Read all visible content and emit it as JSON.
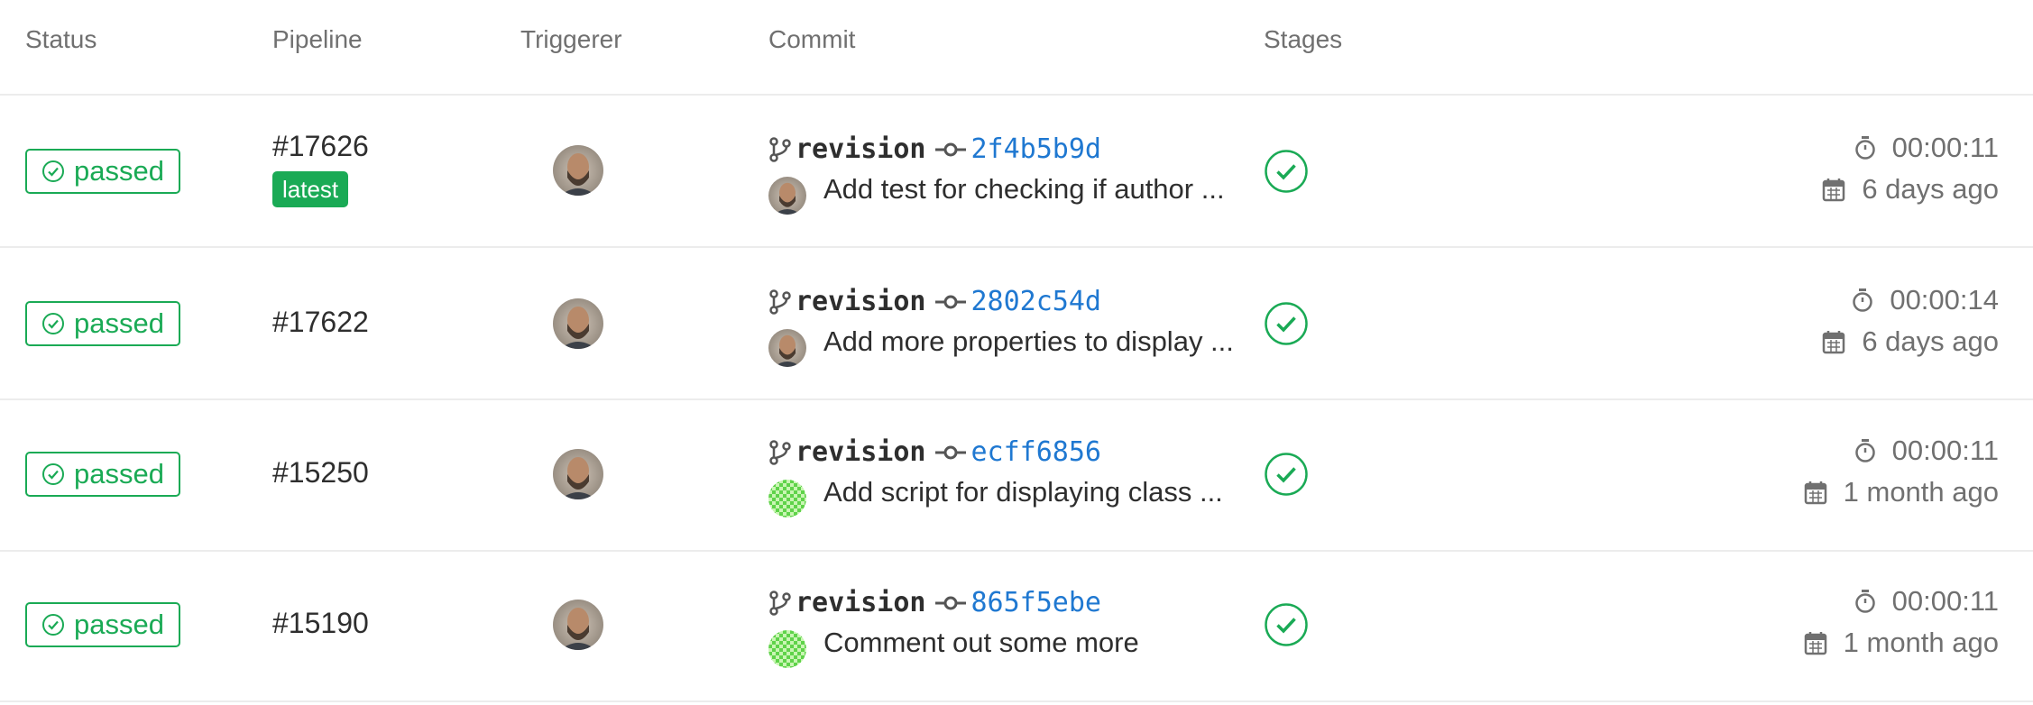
{
  "headers": {
    "status": "Status",
    "pipeline": "Pipeline",
    "triggerer": "Triggerer",
    "commit": "Commit",
    "stages": "Stages"
  },
  "colors": {
    "success": "#1aaa55",
    "link": "#1f78d1",
    "muted": "#707070",
    "text": "#2e2e2e"
  },
  "icons": {
    "status": "status-success-icon",
    "branch": "branch-icon",
    "commit": "commit-icon",
    "stage": "stage-success-icon",
    "duration": "timer-icon",
    "finished": "calendar-icon"
  },
  "rows": [
    {
      "status": "passed",
      "pipeline": "#17626",
      "badge": "latest",
      "branch": "revision",
      "sha": "2f4b5b9d",
      "commit_title": "Add test for checking if author ...",
      "commit_author_avatar": "photo",
      "duration": "00:00:11",
      "finished": "6 days ago"
    },
    {
      "status": "passed",
      "pipeline": "#17622",
      "branch": "revision",
      "sha": "2802c54d",
      "commit_title": "Add more properties to display ...",
      "commit_author_avatar": "photo",
      "duration": "00:00:14",
      "finished": "6 days ago"
    },
    {
      "status": "passed",
      "pipeline": "#15250",
      "branch": "revision",
      "sha": "ecff6856",
      "commit_title": "Add script for displaying class ...",
      "commit_author_avatar": "identicon",
      "duration": "00:00:11",
      "finished": "1 month ago"
    },
    {
      "status": "passed",
      "pipeline": "#15190",
      "branch": "revision",
      "sha": "865f5ebe",
      "commit_title": "Comment out some more",
      "commit_author_avatar": "identicon",
      "duration": "00:00:11",
      "finished": "1 month ago"
    }
  ]
}
